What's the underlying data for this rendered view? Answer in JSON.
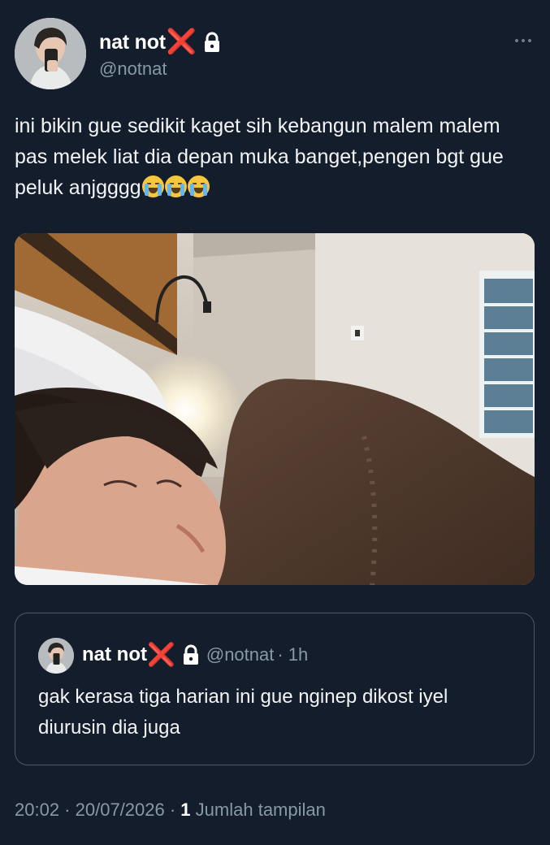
{
  "author": {
    "name": "nat not",
    "badge": "❌",
    "handle": "@notnat",
    "avatar_icon": "profile-selfie-avatar"
  },
  "tweet": {
    "text": "ini bikin gue sedikit kaget sih kebangun malem malem pas melek liat dia depan muka banget,pengen bgt gue peluk anjgggg",
    "emoji_count": 3,
    "emoji_name": "loudly-crying-face"
  },
  "media": {
    "type": "photo",
    "icon": "photo-sleeping-person"
  },
  "quote": {
    "name": "nat not",
    "badge": "❌",
    "handle": "@notnat",
    "time": "· 1h",
    "text": "gak kerasa tiga harian ini gue nginep dikost iyel diurusin dia juga"
  },
  "meta": {
    "time": "20:02",
    "date": "20/07/2026",
    "separator": " · ",
    "views_count": "1",
    "views_label": "Jumlah tampilan"
  },
  "icons": {
    "lock": "lock-icon",
    "more": "more-icon"
  },
  "colors": {
    "background": "#141d2b",
    "text": "#f2f4f5",
    "secondary": "#8899a6",
    "badge_red": "#e2231a",
    "border": "#4a5868"
  }
}
